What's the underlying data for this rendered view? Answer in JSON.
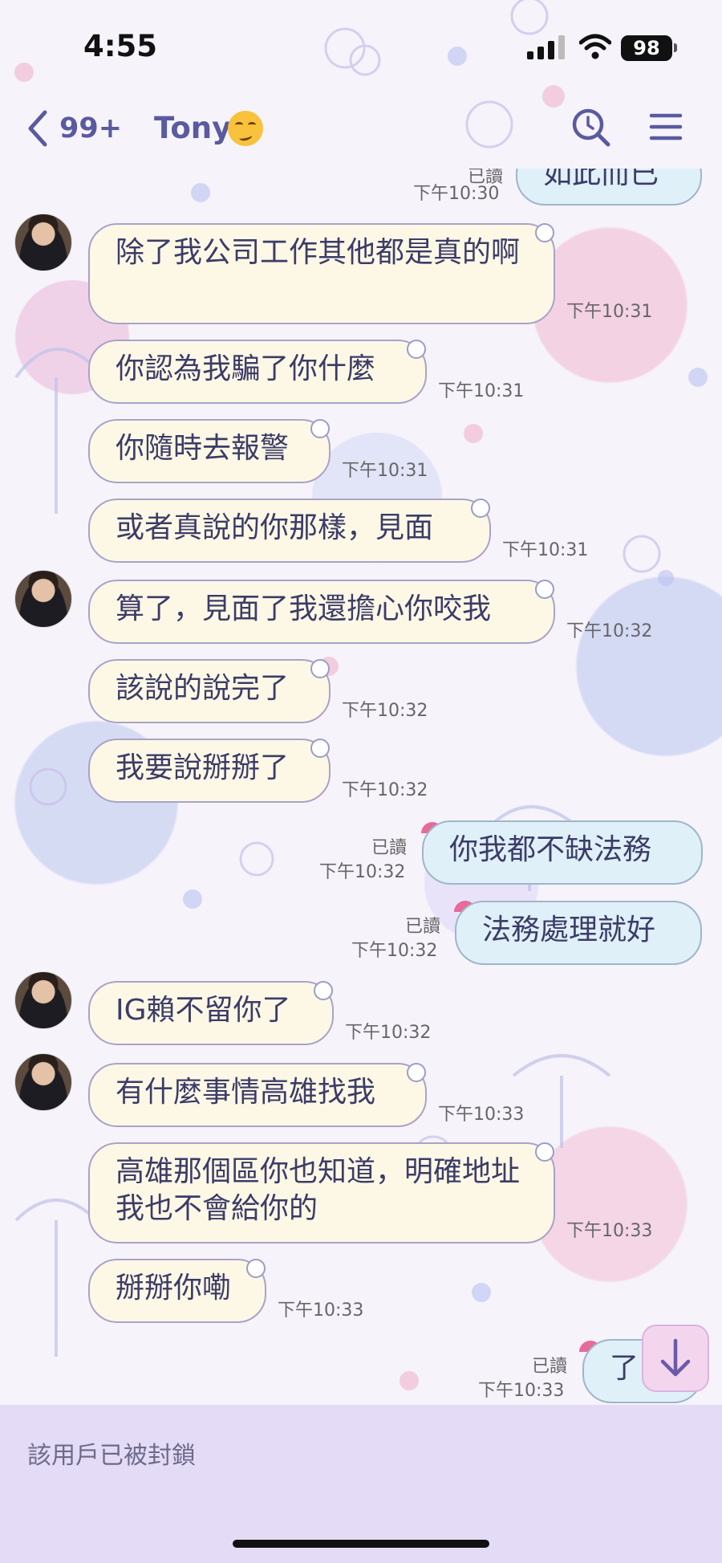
{
  "status_bar": {
    "time": "4:55",
    "battery": "98",
    "colors": {
      "text": "#111111"
    }
  },
  "header": {
    "unread_count": "99+",
    "contact_name": "Tony",
    "contact_emoji": "woozy-face-icon",
    "icons": [
      "back-chevron-icon",
      "search-icon",
      "menu-icon"
    ],
    "accent_color": "#5a5aa0"
  },
  "messages": [
    {
      "side": "out",
      "text": "如此而已",
      "time": "下午10:30",
      "read": "已讀"
    },
    {
      "side": "in",
      "text": "除了我公司工作其他都是真的啊",
      "time": "下午10:31"
    },
    {
      "side": "in",
      "text": "你認為我騙了你什麼",
      "time": "下午10:31"
    },
    {
      "side": "in",
      "text": "你隨時去報警",
      "time": "下午10:31"
    },
    {
      "side": "in",
      "text": "或者真說的你那樣，見面",
      "time": "下午10:31"
    },
    {
      "side": "in",
      "text": "算了，見面了我還擔心你咬我",
      "time": "下午10:32"
    },
    {
      "side": "in",
      "text": "該說的說完了",
      "time": "下午10:32"
    },
    {
      "side": "in",
      "text": "我要說掰掰了",
      "time": "下午10:32"
    },
    {
      "side": "out",
      "text": "你我都不缺法務",
      "time": "下午10:32",
      "read": "已讀"
    },
    {
      "side": "out",
      "text": "法務處理就好",
      "time": "下午10:32",
      "read": "已讀"
    },
    {
      "side": "in",
      "text": "IG賴不留你了",
      "time": "下午10:32"
    },
    {
      "side": "in",
      "text": "有什麼事情高雄找我",
      "time": "下午10:33"
    },
    {
      "side": "in",
      "text": "高雄那個區你也知道，明確地址我也不會給你的",
      "time": "下午10:33"
    },
    {
      "side": "in",
      "text": "掰掰你嘞",
      "time": "下午10:33"
    },
    {
      "side": "out",
      "text": "了",
      "time": "下午10:33",
      "read": "已讀"
    }
  ],
  "bubble_colors": {
    "incoming": "#fdf8e6",
    "outgoing": "#dff0f8",
    "text": "#3c3c68"
  },
  "footer": {
    "blocked_text": "該用戶已被封鎖",
    "background": "#e4dcf6"
  },
  "scroll_button_icon": "arrow-down-icon"
}
